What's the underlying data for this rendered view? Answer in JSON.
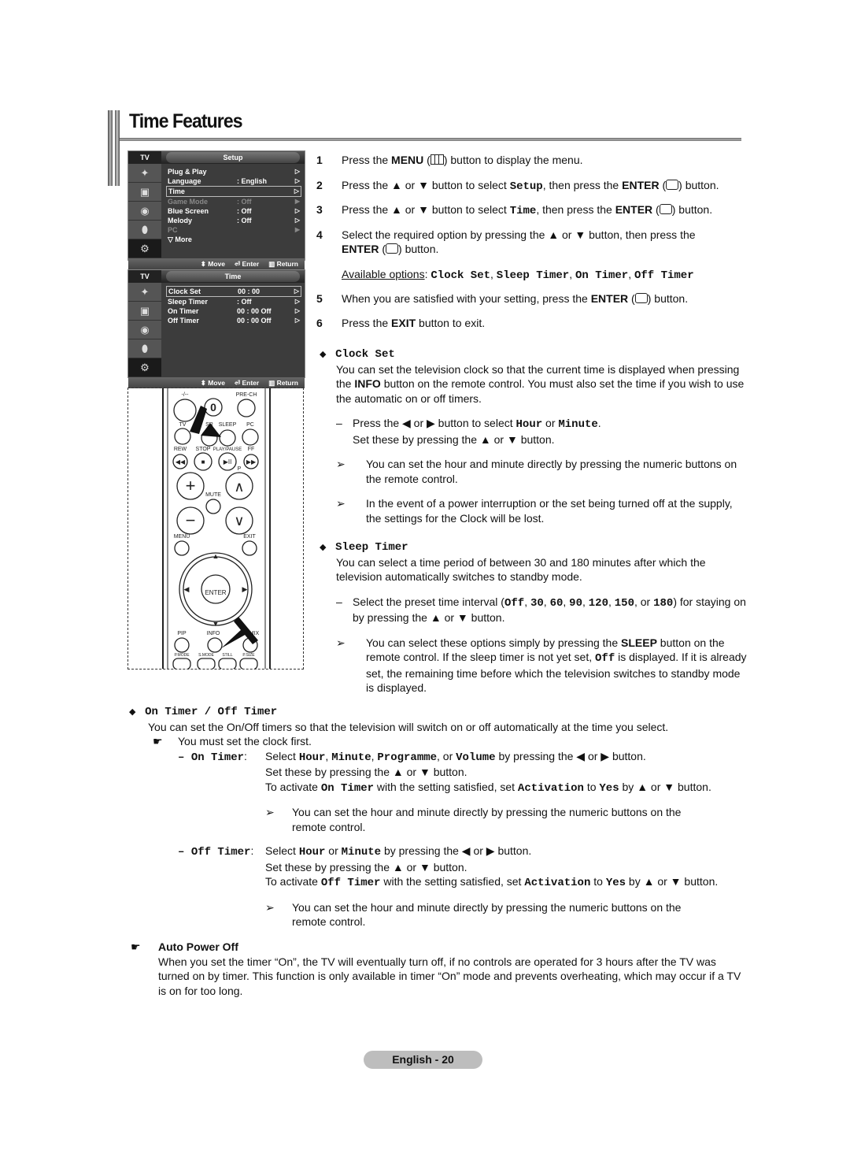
{
  "header": {
    "title": "Time Features"
  },
  "osd_setup": {
    "tv_label": "TV",
    "title": "Setup",
    "items": [
      {
        "label": "Plug & Play",
        "value": "",
        "state": "normal"
      },
      {
        "label": "Language",
        "value": ": English",
        "state": "normal"
      },
      {
        "label": "Time",
        "value": "",
        "state": "highlighted"
      },
      {
        "label": "Game Mode",
        "value": ": Off",
        "state": "disabled"
      },
      {
        "label": "Blue Screen",
        "value": ": Off",
        "state": "normal"
      },
      {
        "label": "Melody",
        "value": ": Off",
        "state": "normal"
      },
      {
        "label": "PC",
        "value": "",
        "state": "disabled"
      },
      {
        "label": "▽ More",
        "value": "",
        "state": "normal"
      }
    ],
    "footer": {
      "move": "Move",
      "enter": "Enter",
      "return": "Return"
    }
  },
  "osd_time": {
    "tv_label": "TV",
    "title": "Time",
    "items": [
      {
        "label": "Clock Set",
        "value": "00 : 00",
        "state": "highlighted"
      },
      {
        "label": "Sleep Timer",
        "value": ": Off",
        "state": "normal"
      },
      {
        "label": "On Timer",
        "value": "00 : 00   Off",
        "state": "normal"
      },
      {
        "label": "Off Timer",
        "value": "00 : 00   Off",
        "state": "normal"
      }
    ],
    "footer": {
      "move": "Move",
      "enter": "Enter",
      "return": "Return"
    }
  },
  "remote": {
    "labels": {
      "dash": "-/--",
      "zero": "0",
      "prech": "PRE-CH",
      "tv": "TV",
      "sr": "SR",
      "sleep": "SLEEP",
      "pc": "PC",
      "rew": "REW",
      "stop": "STOP",
      "playpause": "PLAY/PAUSE",
      "ff": "FF",
      "p": "P",
      "mute": "MUTE",
      "menu": "MENU",
      "exit": "EXIT",
      "enter": "ENTER",
      "pip": "PIP",
      "info": "INFO",
      "mix": "MIX",
      "pmode": "P.MODE",
      "smode": "S.MODE",
      "still": "STILL",
      "psize": "P.SIZE"
    }
  },
  "steps": [
    {
      "num": "1",
      "pre": "Press the ",
      "b1": "MENU",
      "post": " button to display the menu."
    },
    {
      "num": "2",
      "pre": "Press the ▲ or ▼ button to select ",
      "code": "Setup",
      "mid": ", then press the ",
      "b1": "ENTER",
      "post": " button."
    },
    {
      "num": "3",
      "pre": "Press the ▲ or ▼ button to select ",
      "code": "Time",
      "mid": ", then press the ",
      "b1": "ENTER",
      "post": " button."
    },
    {
      "num": "4",
      "pre": "Select the required option by pressing the ▲ or ▼ button, then press the",
      "b1": "ENTER",
      "post": " button."
    },
    {
      "num": "5",
      "pre": "When you are satisfied with your setting, press the ",
      "b1": "ENTER",
      "post": " button."
    },
    {
      "num": "6",
      "pre": "Press the ",
      "b1": "EXIT",
      "post": " button to exit."
    }
  ],
  "available": {
    "label": "Available options",
    "options": [
      "Clock Set",
      "Sleep Timer",
      "On Timer",
      "Off Timer"
    ]
  },
  "clock_set": {
    "heading": "Clock Set",
    "p1a": "You can set the television clock so that the current time is displayed when pressing the ",
    "p1b": "INFO",
    "p1c": " button on the remote control. You must also set the time if you wish to use the automatic on or off timers.",
    "dash_a": "Press the ◀ or ▶ button to select ",
    "dash_hour": "Hour",
    "dash_or": " or ",
    "dash_minute": "Minute",
    "dash_b": "Set these by pressing the ▲ or ▼ button.",
    "note1": "You can set the hour and minute directly by pressing the numeric buttons on the remote control.",
    "note2": "In the event of a power interruption or the set being turned off at the supply, the settings for the Clock will be lost."
  },
  "sleep_timer": {
    "heading": "Sleep Timer",
    "p1": "You can select a time period of between 30 and 180 minutes after which the television automatically switches to standby mode.",
    "dash_a": "Select the preset time interval (",
    "intervals": [
      "Off",
      "30",
      "60",
      "90",
      "120",
      "150",
      "180"
    ],
    "dash_b": ") for staying on by pressing the ▲ or ▼ button.",
    "note_a": "You can select these options simply by pressing the ",
    "note_b": "SLEEP",
    "note_c": " button on the remote control. If the sleep timer is not yet set, ",
    "note_off": "Off",
    "note_d": " is displayed. If it is already set, the remaining time before which the television switches to standby mode is displayed."
  },
  "on_off_timer": {
    "heading": "On Timer / Off Timer",
    "p1": "You can set the On/Off timers so that the television will switch on or off automatically at the time you select.",
    "hand_note": "You must set the clock first.",
    "on": {
      "label": "On Timer",
      "l1a": "Select ",
      "hour": "Hour",
      "minute": "Minute",
      "programme": "Programme",
      "volume": "Volume",
      "l1b": " by pressing the ◀ or ▶ button.",
      "l2": "Set these by pressing the ▲ or ▼ button.",
      "l3a": "To activate ",
      "l3code": "On Timer",
      "l3b": " with the setting satisfied, set ",
      "activation": "Activation",
      "to": " to ",
      "yes": "Yes",
      "l3c": " by ▲ or ▼ button.",
      "note": "You can set the hour and minute directly by pressing the numeric buttons on the remote control."
    },
    "off": {
      "label": "Off Timer",
      "l1a": "Select ",
      "hour": "Hour",
      "or": " or ",
      "minute": "Minute",
      "l1b": " by pressing the ◀ or ▶ button.",
      "l2": "Set these by pressing the ▲ or ▼ button.",
      "l3a": "To activate ",
      "l3code": "Off Timer",
      "l3b": " with the setting satisfied, set ",
      "activation": "Activation",
      "to": " to ",
      "yes": "Yes",
      "l3c": " by ▲ or ▼ button.",
      "note": "You can set the hour and minute directly by pressing the numeric buttons on the remote control."
    }
  },
  "auto_power_off": {
    "heading": "Auto Power Off",
    "body": "When you set the timer “On”, the TV will eventually turn off, if no controls are operated for 3 hours after the TV was turned on by timer. This function is only available in timer “On” mode and prevents overheating, which may occur if a TV is on for too long."
  },
  "footer": {
    "page_label": "English - 20"
  }
}
